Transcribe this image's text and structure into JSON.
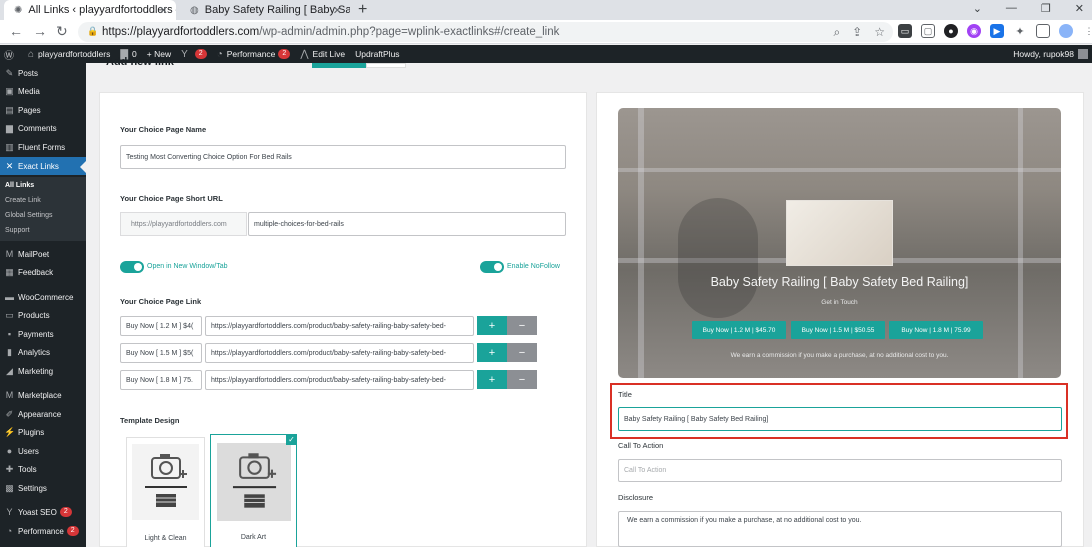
{
  "browser": {
    "tabs": [
      {
        "title": "All Links ‹ playyardfortoddlers —"
      },
      {
        "title": "Baby Safety Railing [ Baby Safety"
      }
    ],
    "url_host": "https://playyardfortoddlers.com",
    "url_path": "/wp-admin/admin.php?page=wplink-exactlinks#/create_link"
  },
  "adminbar": {
    "site": "playyardfortoddlers",
    "comments": "0",
    "new": "+ New",
    "yoast_count": "2",
    "performance": "Performance",
    "performance_count": "2",
    "edit_live": "Edit Live",
    "updraft": "UpdraftPlus",
    "howdy": "Howdy, rupok98"
  },
  "sidebar": {
    "items": [
      {
        "label": "Posts",
        "icon": "pin-icon"
      },
      {
        "label": "Media",
        "icon": "media-icon"
      },
      {
        "label": "Pages",
        "icon": "pages-icon"
      },
      {
        "label": "Comments",
        "icon": "comments-icon"
      },
      {
        "label": "Fluent Forms",
        "icon": "forms-icon"
      },
      {
        "label": "Exact Links",
        "icon": "exact-links-icon"
      },
      {
        "label": "MailPoet",
        "icon": "mailpoet-icon"
      },
      {
        "label": "Feedback",
        "icon": "feedback-icon"
      },
      {
        "label": "WooCommerce",
        "icon": "woocommerce-icon"
      },
      {
        "label": "Products",
        "icon": "products-icon"
      },
      {
        "label": "Payments",
        "icon": "payments-icon"
      },
      {
        "label": "Analytics",
        "icon": "analytics-icon"
      },
      {
        "label": "Marketing",
        "icon": "marketing-icon"
      },
      {
        "label": "Marketplace",
        "icon": "marketplace-icon"
      },
      {
        "label": "Appearance",
        "icon": "appearance-icon"
      },
      {
        "label": "Plugins",
        "icon": "plugins-icon"
      },
      {
        "label": "Users",
        "icon": "users-icon"
      },
      {
        "label": "Tools",
        "icon": "tools-icon"
      },
      {
        "label": "Settings",
        "icon": "settings-icon"
      },
      {
        "label": "Yoast SEO",
        "icon": "yoast-icon",
        "badge": "2"
      },
      {
        "label": "Performance",
        "icon": "performance-icon",
        "badge": "2"
      }
    ],
    "submenu": [
      "All Links",
      "Create Link",
      "Global Settings",
      "Support"
    ]
  },
  "page": {
    "title": "Add new link"
  },
  "form": {
    "choice_page_name_label": "Your Choice Page Name",
    "choice_page_name_value": "Testing Most Converting Choice Option For Bed Rails",
    "short_url_label": "Your Choice Page Short URL",
    "short_url_prefix": "https://playyardfortoddlers.com",
    "short_url_value": "multiple-choices-for-bed-rails",
    "open_new_window_label": "Open in New Window/Tab",
    "nofollow_label": "Enable NoFollow",
    "page_link_label": "Your Choice Page Link",
    "links": [
      {
        "text": "Buy Now [ 1.2 M ] $4(",
        "url": "https://playyardfortoddlers.com/product/baby-safety-railing-baby-safety-bed-"
      },
      {
        "text": "Buy Now [ 1.5 M ] $5(",
        "url": "https://playyardfortoddlers.com/product/baby-safety-railing-baby-safety-bed-"
      },
      {
        "text": "Buy Now [ 1.8 M ] 75.",
        "url": "https://playyardfortoddlers.com/product/baby-safety-railing-baby-safety-bed-"
      }
    ],
    "plus_label": "+",
    "minus_label": "−",
    "template_label": "Template Design",
    "templates": [
      {
        "name": "Light & Clean"
      },
      {
        "name": "Dark Art"
      }
    ]
  },
  "preview": {
    "title": "Baby Safety Railing [ Baby Safety Bed Railing]",
    "subtitle": "Get in Touch",
    "buttons": [
      "Buy Now | 1.2 M | $45.70",
      "Buy Now | 1.5 M | $50.55",
      "Buy Now | 1.8 M | 75.99"
    ],
    "note": "We earn a commission if you make a purchase, at no additional cost to you."
  },
  "right_form": {
    "title_label": "Title",
    "title_value": "Baby Safety Railing [ Baby Safety Bed Railing]",
    "cta_label": "Call To Action",
    "cta_placeholder": "Call To Action",
    "disclosure_label": "Disclosure",
    "disclosure_value": "We earn a commission if you make a purchase, at no additional cost to you."
  },
  "colors": {
    "accent": "#1aa39a",
    "wp_dark": "#1d2327",
    "wp_blue": "#2271b1",
    "highlight_red": "#d93025"
  }
}
